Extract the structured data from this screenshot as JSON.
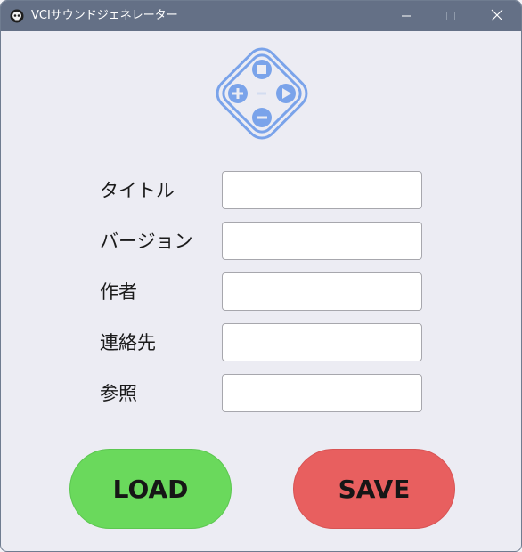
{
  "window": {
    "title": "VCIサウンドジェネレーター",
    "icons": {
      "app": "skull-app-icon",
      "minimize": "minimize-icon",
      "maximize": "maximize-icon",
      "close": "close-icon"
    }
  },
  "logo": {
    "icon": "gamepad-dpad-logo-icon",
    "color": "#7aa3ea"
  },
  "form": {
    "fields": [
      {
        "label": "タイトル",
        "value": ""
      },
      {
        "label": "バージョン",
        "value": ""
      },
      {
        "label": "作者",
        "value": ""
      },
      {
        "label": "連絡先",
        "value": ""
      },
      {
        "label": "参照",
        "value": ""
      }
    ]
  },
  "actions": {
    "load_label": "LOAD",
    "save_label": "SAVE",
    "load_color": "#6ad95c",
    "save_color": "#e85f5f"
  },
  "colors": {
    "titlebar": "#647086",
    "window_bg": "#ececf3"
  }
}
